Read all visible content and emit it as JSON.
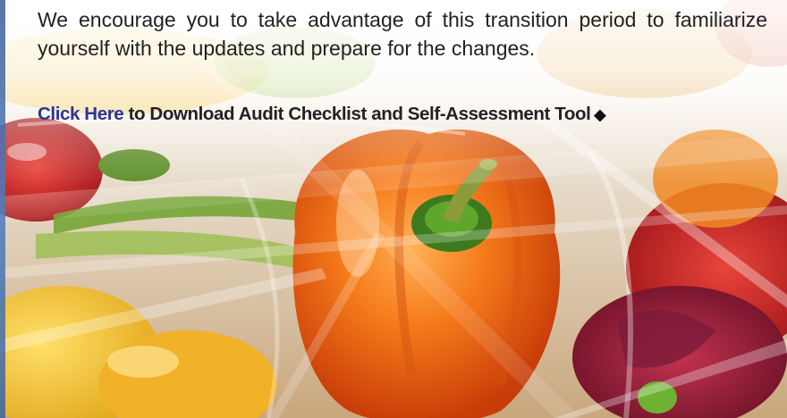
{
  "body": {
    "paragraph": "We encourage you to take advantage of this transition period to familiarize yourself with the updates and prepare for the changes.",
    "cta_link": "Click Here",
    "cta_text": " to Download Audit Checklist and Self-Assessment Tool",
    "cta_marker": "◆"
  },
  "colors": {
    "link": "#2e3592",
    "text": "#222222",
    "pepper": "#f2650f"
  }
}
